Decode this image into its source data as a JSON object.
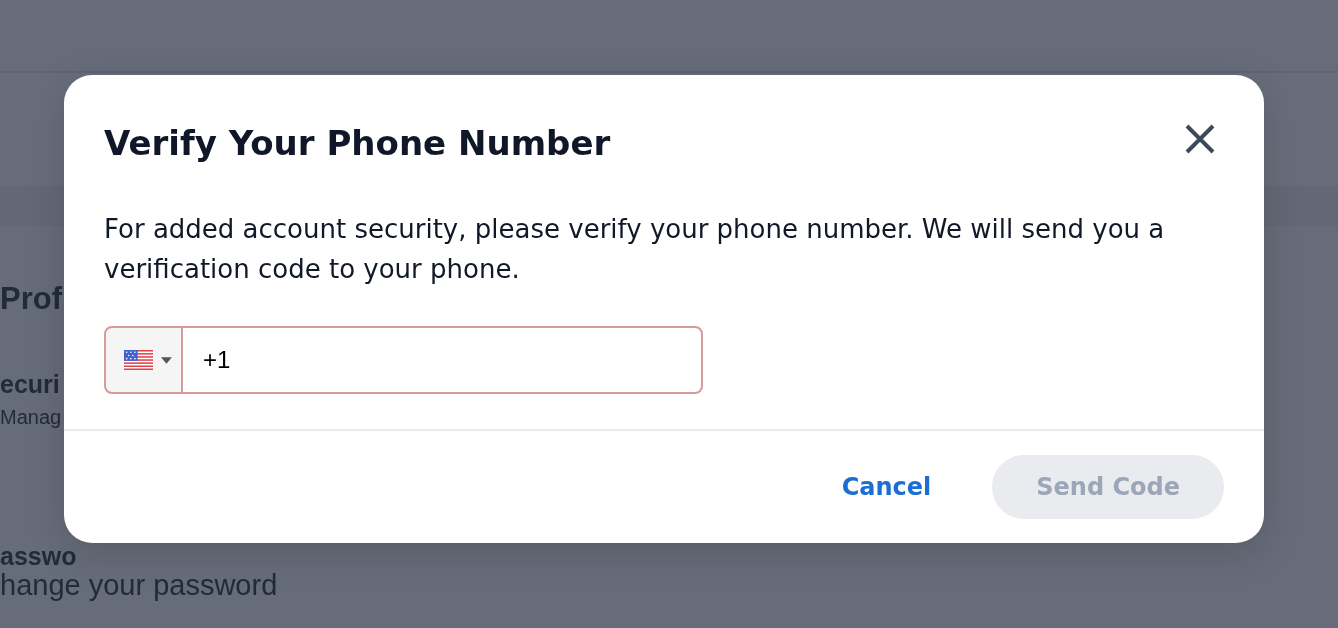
{
  "background_page": {
    "heading": "Prof",
    "settings": [
      {
        "title": "ecuri",
        "description": "Manag"
      },
      {
        "title": "asswo",
        "description": "hange your password"
      }
    ]
  },
  "dialog": {
    "title": "Verify Your Phone Number",
    "message": "For added account security, please verify your phone number. We will send you a verification code to your phone.",
    "phone_field": {
      "value": "+1",
      "invalid": true
    },
    "buttons": [
      {
        "label": "Cancel",
        "kind": "link",
        "disabled": false
      },
      {
        "label": "Send Code",
        "kind": "primary",
        "disabled": true
      }
    ]
  }
}
